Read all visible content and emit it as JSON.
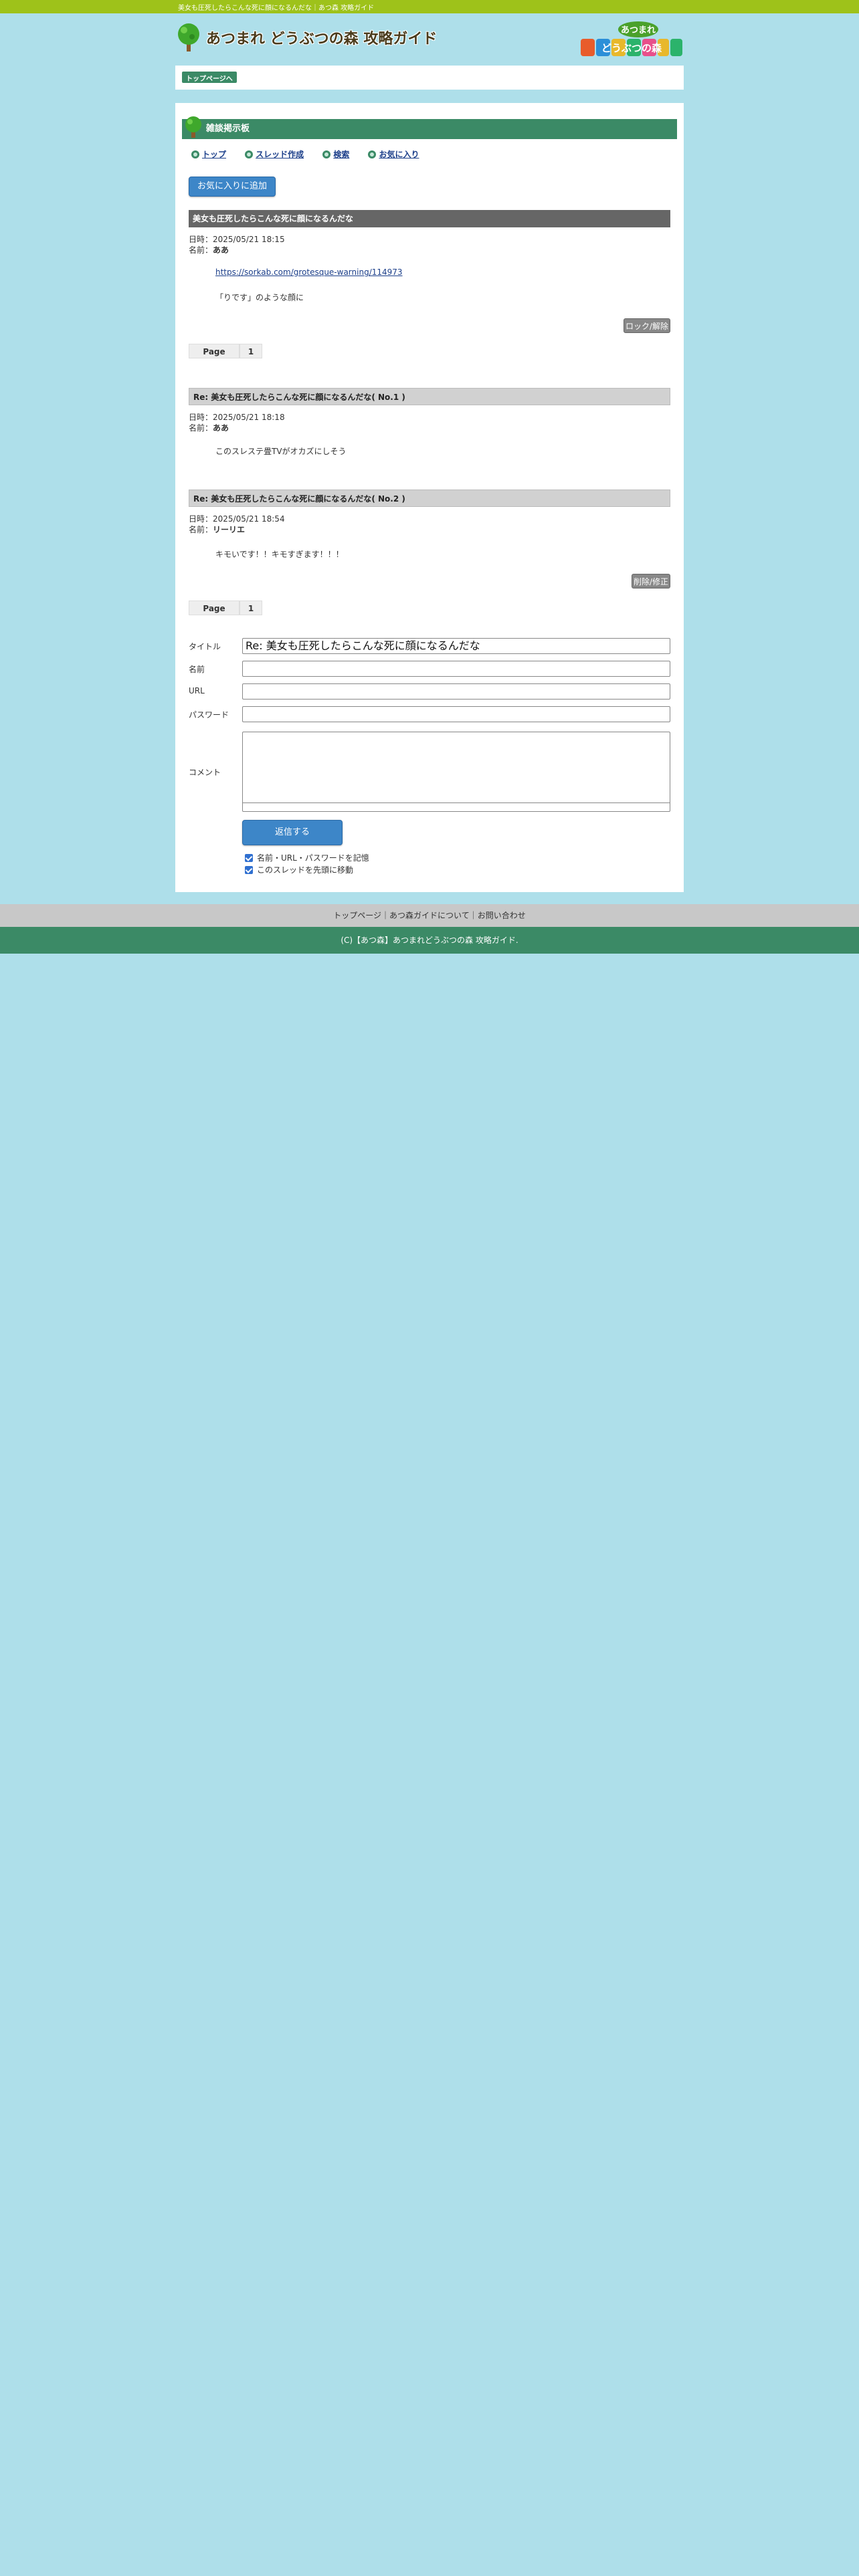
{
  "top_strip": {
    "text": "美女も圧死したらこんな死に顔になるんだな｜あつ森 攻略ガイド"
  },
  "header": {
    "site_title": "あつまれ どうぶつの森 攻略ガイド",
    "logo_right": [
      "あつまれ",
      "どうぶつの森"
    ]
  },
  "breadcrumb": {
    "top_link": "トップページへ"
  },
  "bbs": {
    "title": "雑談掲示板",
    "nav": {
      "top": "トップ",
      "create_thread": "スレッド作成",
      "search": "検索",
      "favorites": "お気に入り"
    },
    "add_favorite": "お気に入りに追加"
  },
  "labels": {
    "date": "日時：",
    "name": "名前：",
    "page": "Page"
  },
  "thread": {
    "title": "美女も圧死したらこんな死に顔になるんだな",
    "date": "2025/05/21 18:15",
    "author": "ああ",
    "link": "https://sorkab.com/grotesque-warning/114973",
    "body": "「りです」のような顔に",
    "lock_button": "ロック/解除",
    "page_number": "1"
  },
  "replies": [
    {
      "title": "Re: 美女も圧死したらこんな死に顔になるんだな( No.1 )",
      "date": "2025/05/21 18:18",
      "author": "ああ",
      "body": "このスレステ畳TVがオカズにしそう"
    },
    {
      "title": "Re: 美女も圧死したらこんな死に顔になるんだな( No.2 )",
      "date": "2025/05/21 18:54",
      "author": "リーリエ",
      "body": "キモいです！！キモすぎます！！！",
      "delete_button": "削除/修正"
    }
  ],
  "page2": {
    "page_number": "1"
  },
  "form": {
    "title_label": "タイトル",
    "title_value": "Re: 美女も圧死したらこんな死に顔になるんだな",
    "name_label": "名前",
    "url_label": "URL",
    "password_label": "パスワード",
    "comment_label": "コメント",
    "submit": "返信する",
    "remember": "名前・URL・パスワードを記憶",
    "move_top": "このスレッドを先頭に移動"
  },
  "footer": {
    "links": "トップページ｜あつ森ガイドについて｜お問い合わせ",
    "copyright": "(C)【あつ森】あつまれどうぶつの森 攻略ガイド."
  },
  "colors": {
    "page_bg": "#aedfea",
    "top_strip": "#9ec21a",
    "green": "#3b8a66",
    "blue_button": "#3d86c8",
    "dark_header": "#666666"
  }
}
